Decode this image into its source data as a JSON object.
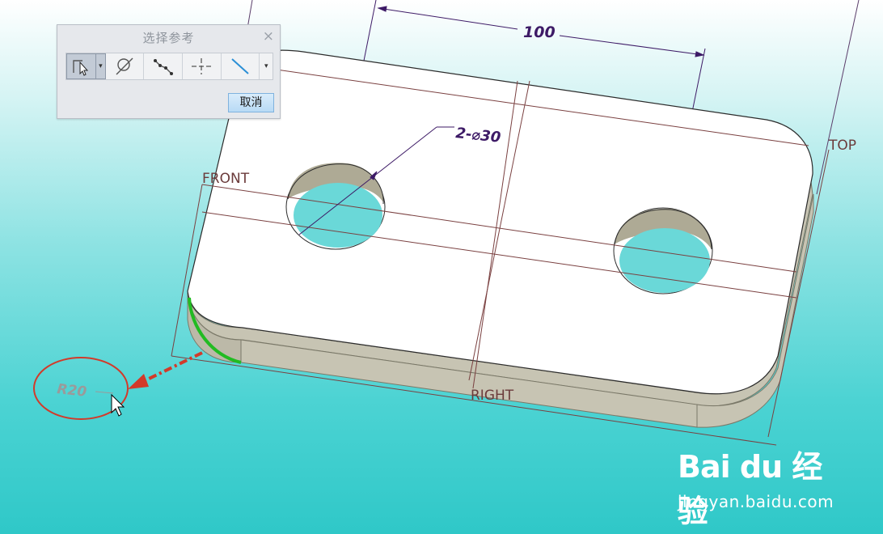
{
  "dialog": {
    "title": "选择参考",
    "close_glyph": "×",
    "tools": [
      "select-reference-icon",
      "circle-sketch-icon",
      "chain-icon",
      "centerline-icon",
      "line-icon"
    ],
    "dropdown_glyph": "▾",
    "cancel_label": "取消"
  },
  "model": {
    "dim_100": "100",
    "dim_hole": "2-⌀30",
    "radius_label": "R20",
    "datum_front": "FRONT",
    "datum_top": "TOP",
    "datum_right": "RIGHT"
  },
  "watermark": {
    "logo": "Bai du 经验",
    "site": "jingyan.baidu.com"
  },
  "colors": {
    "plate_face": "#ffffff",
    "plate_side": "#c7c4b3",
    "hole_inner": "#aeaa95",
    "edge_highlight": "#22bb22",
    "annotation_red": "#d23a2a",
    "dimension": "#3d1a66",
    "datum": "#7a4040"
  }
}
